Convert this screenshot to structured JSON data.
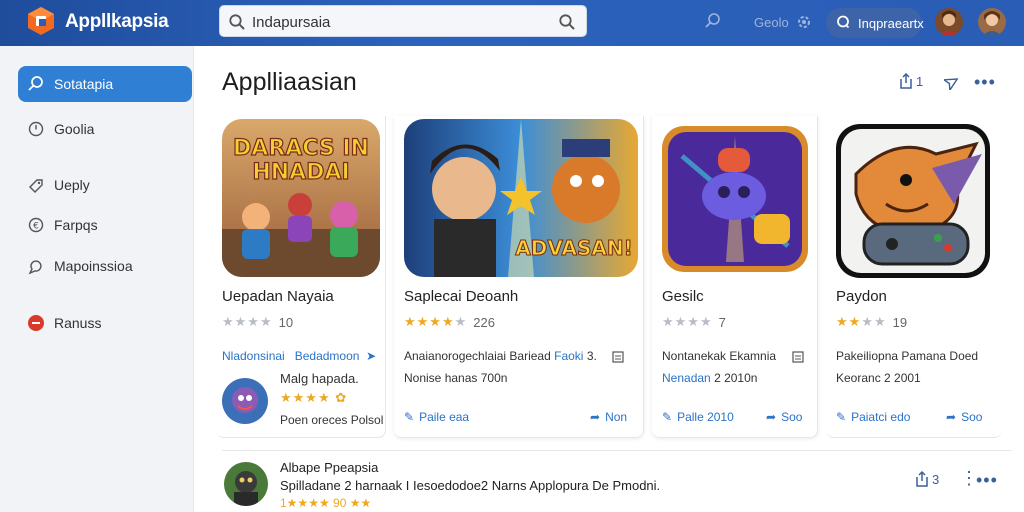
{
  "topbar": {
    "brand": "Appllkapsia",
    "search_value": "Indapursaia",
    "link": "Geolo",
    "profile_pill": "Inqpraeartx",
    "colors": {
      "bar": "#2a5db5",
      "accent": "#2f7fd5",
      "star": "#f0a81f"
    }
  },
  "sidebar": {
    "items": [
      {
        "label": "Sotatapia",
        "icon": "search-icon"
      },
      {
        "label": "Goolia",
        "icon": "clock-icon"
      },
      {
        "label": "Ueply",
        "icon": "tag-icon"
      },
      {
        "label": "Farpqs",
        "icon": "dollar-icon"
      },
      {
        "label": "Mapoinssioa",
        "icon": "chat-icon"
      },
      {
        "label": "Ranuss",
        "icon": "red-badge-icon"
      }
    ]
  },
  "main": {
    "title": "Applliaasian",
    "header_action_count": "1"
  },
  "cards": [
    {
      "name": "Uepadan Nayaia",
      "thumb_text": "DARACS IN HNADAI",
      "stars_filled": 0,
      "rating_count": "10",
      "line1_left": "Nladonsinai",
      "line1_right": "Bedadmoon",
      "featured_name": "Malg hapada.",
      "featured_desc": "Poen oreces Polsol"
    },
    {
      "name": "Saplecai Deoanh",
      "thumb_text": "ADVASAN!",
      "stars_filled": 4,
      "rating_count": "226",
      "line1": "Anaianorogechlaiai Bariead",
      "line1_blue": "Faoki",
      "line1_end": "3.",
      "line2": "Nonise hanas 700n",
      "act_left": "Paile eaa",
      "act_right": "Non"
    },
    {
      "name": "Gesilc",
      "stars_filled": 0,
      "rating_count": "7",
      "line1": "Nontanekak Ekamnia",
      "line2_blue": "Nenadan",
      "line2": "2 2010n",
      "act_left": "Palle 2010",
      "act_right": "Soo"
    },
    {
      "name": "Paydon",
      "stars_filled": 2,
      "rating_count": "19",
      "line1": "Pakeiliopna Pamana Doed",
      "line2": "Keoranc 2 2001",
      "act_left": "Paiatci edo",
      "act_right": "Soo"
    }
  ],
  "bottom": {
    "title": "Albape Ppeapsia",
    "subtitle": "Spilladane 2 harnaak I Iesoedodoe2 Narns Applopura De Pmodni.",
    "rating_line": "1★★★★ 90 ★★",
    "action_count": "3"
  }
}
